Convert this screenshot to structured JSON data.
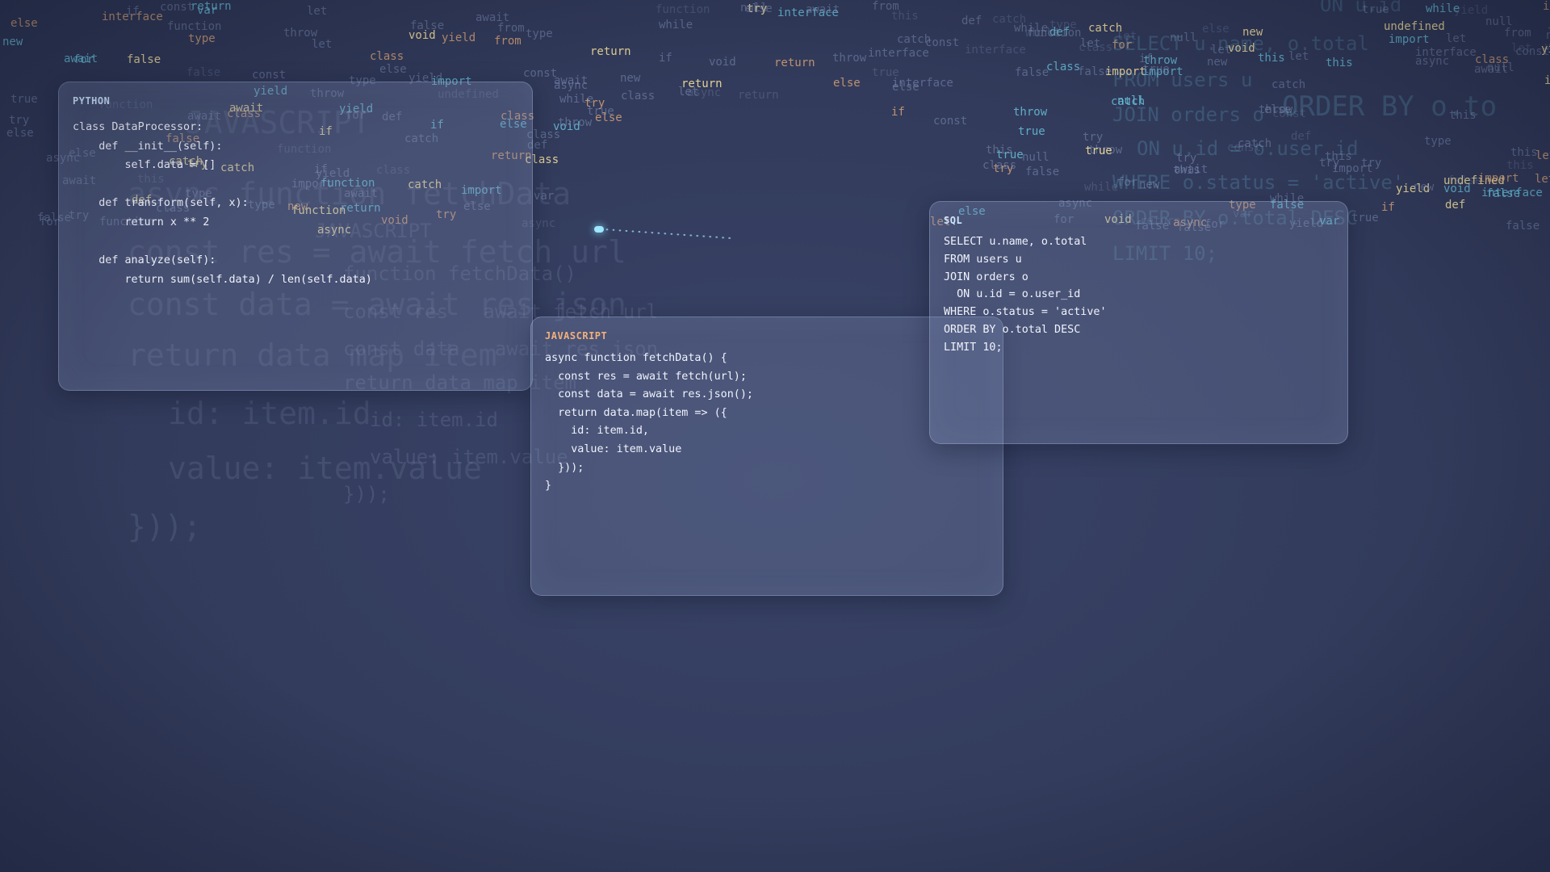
{
  "panels": {
    "python": {
      "label": "PYTHON",
      "code": "class DataProcessor:\n    def __init__(self):\n        self.data = []\n\n    def transform(self, x):\n        return x ** 2\n\n    def analyze(self):\n        return sum(self.data) / len(self.data)"
    },
    "javascript": {
      "label": "JAVASCRIPT",
      "code": "async function fetchData() {\n  const res = await fetch(url);\n  const data = await res.json();\n  return data.map(item => ({\n    id: item.id,\n    value: item.value\n  }));\n}"
    },
    "sql": {
      "label": "SQL",
      "code": "SELECT u.name, o.total\nFROM users u\nJOIN orders o\n  ON u.id = o.user_id\nWHERE o.status = 'active'\nORDER BY o.total DESC\nLIMIT 10;"
    }
  },
  "ghost_text": {
    "js_header": "JAVASCRIPT",
    "js_line1": "async function fetchData",
    "js_line2": "const res = await fetch url",
    "js_line3": "const data = await res json",
    "js_line4": "return data map item",
    "js_line5": "id: item.id",
    "js_line6": "value: item.value",
    "js_line7": "}));",
    "js2_line1": "function fetchData()",
    "js2_line2": "const res   await fetch url",
    "js2_line3": "const data   await res json",
    "js2_line4": "return data map item",
    "js2_line5": "id: item.id",
    "js2_line6": "value: item.value",
    "js2_line7": "}));",
    "sql_line1": "SELECT u.name, o.total",
    "sql_line2": "FROM users u",
    "sql_line3": "JOIN orders o",
    "sql_line4": "ON u.id = o.user_id",
    "sql_line5": "WHERE o.status = 'active'",
    "sql_line6": "ORDER BY o.total DESC",
    "sql_line7": "LIMIT 10;",
    "top_right1": "ON u.id",
    "top_right2": "ORDER BY o.to"
  },
  "floating_keywords": [
    "class",
    "type",
    "return",
    "false",
    "async",
    "null",
    "else",
    "catch",
    "from",
    "await",
    "if",
    "for",
    "function",
    "new",
    "let",
    "import",
    "const",
    "def",
    "throw",
    "interface",
    "undefined",
    "true",
    "while",
    "var",
    "try",
    "yield",
    "void",
    "this"
  ]
}
